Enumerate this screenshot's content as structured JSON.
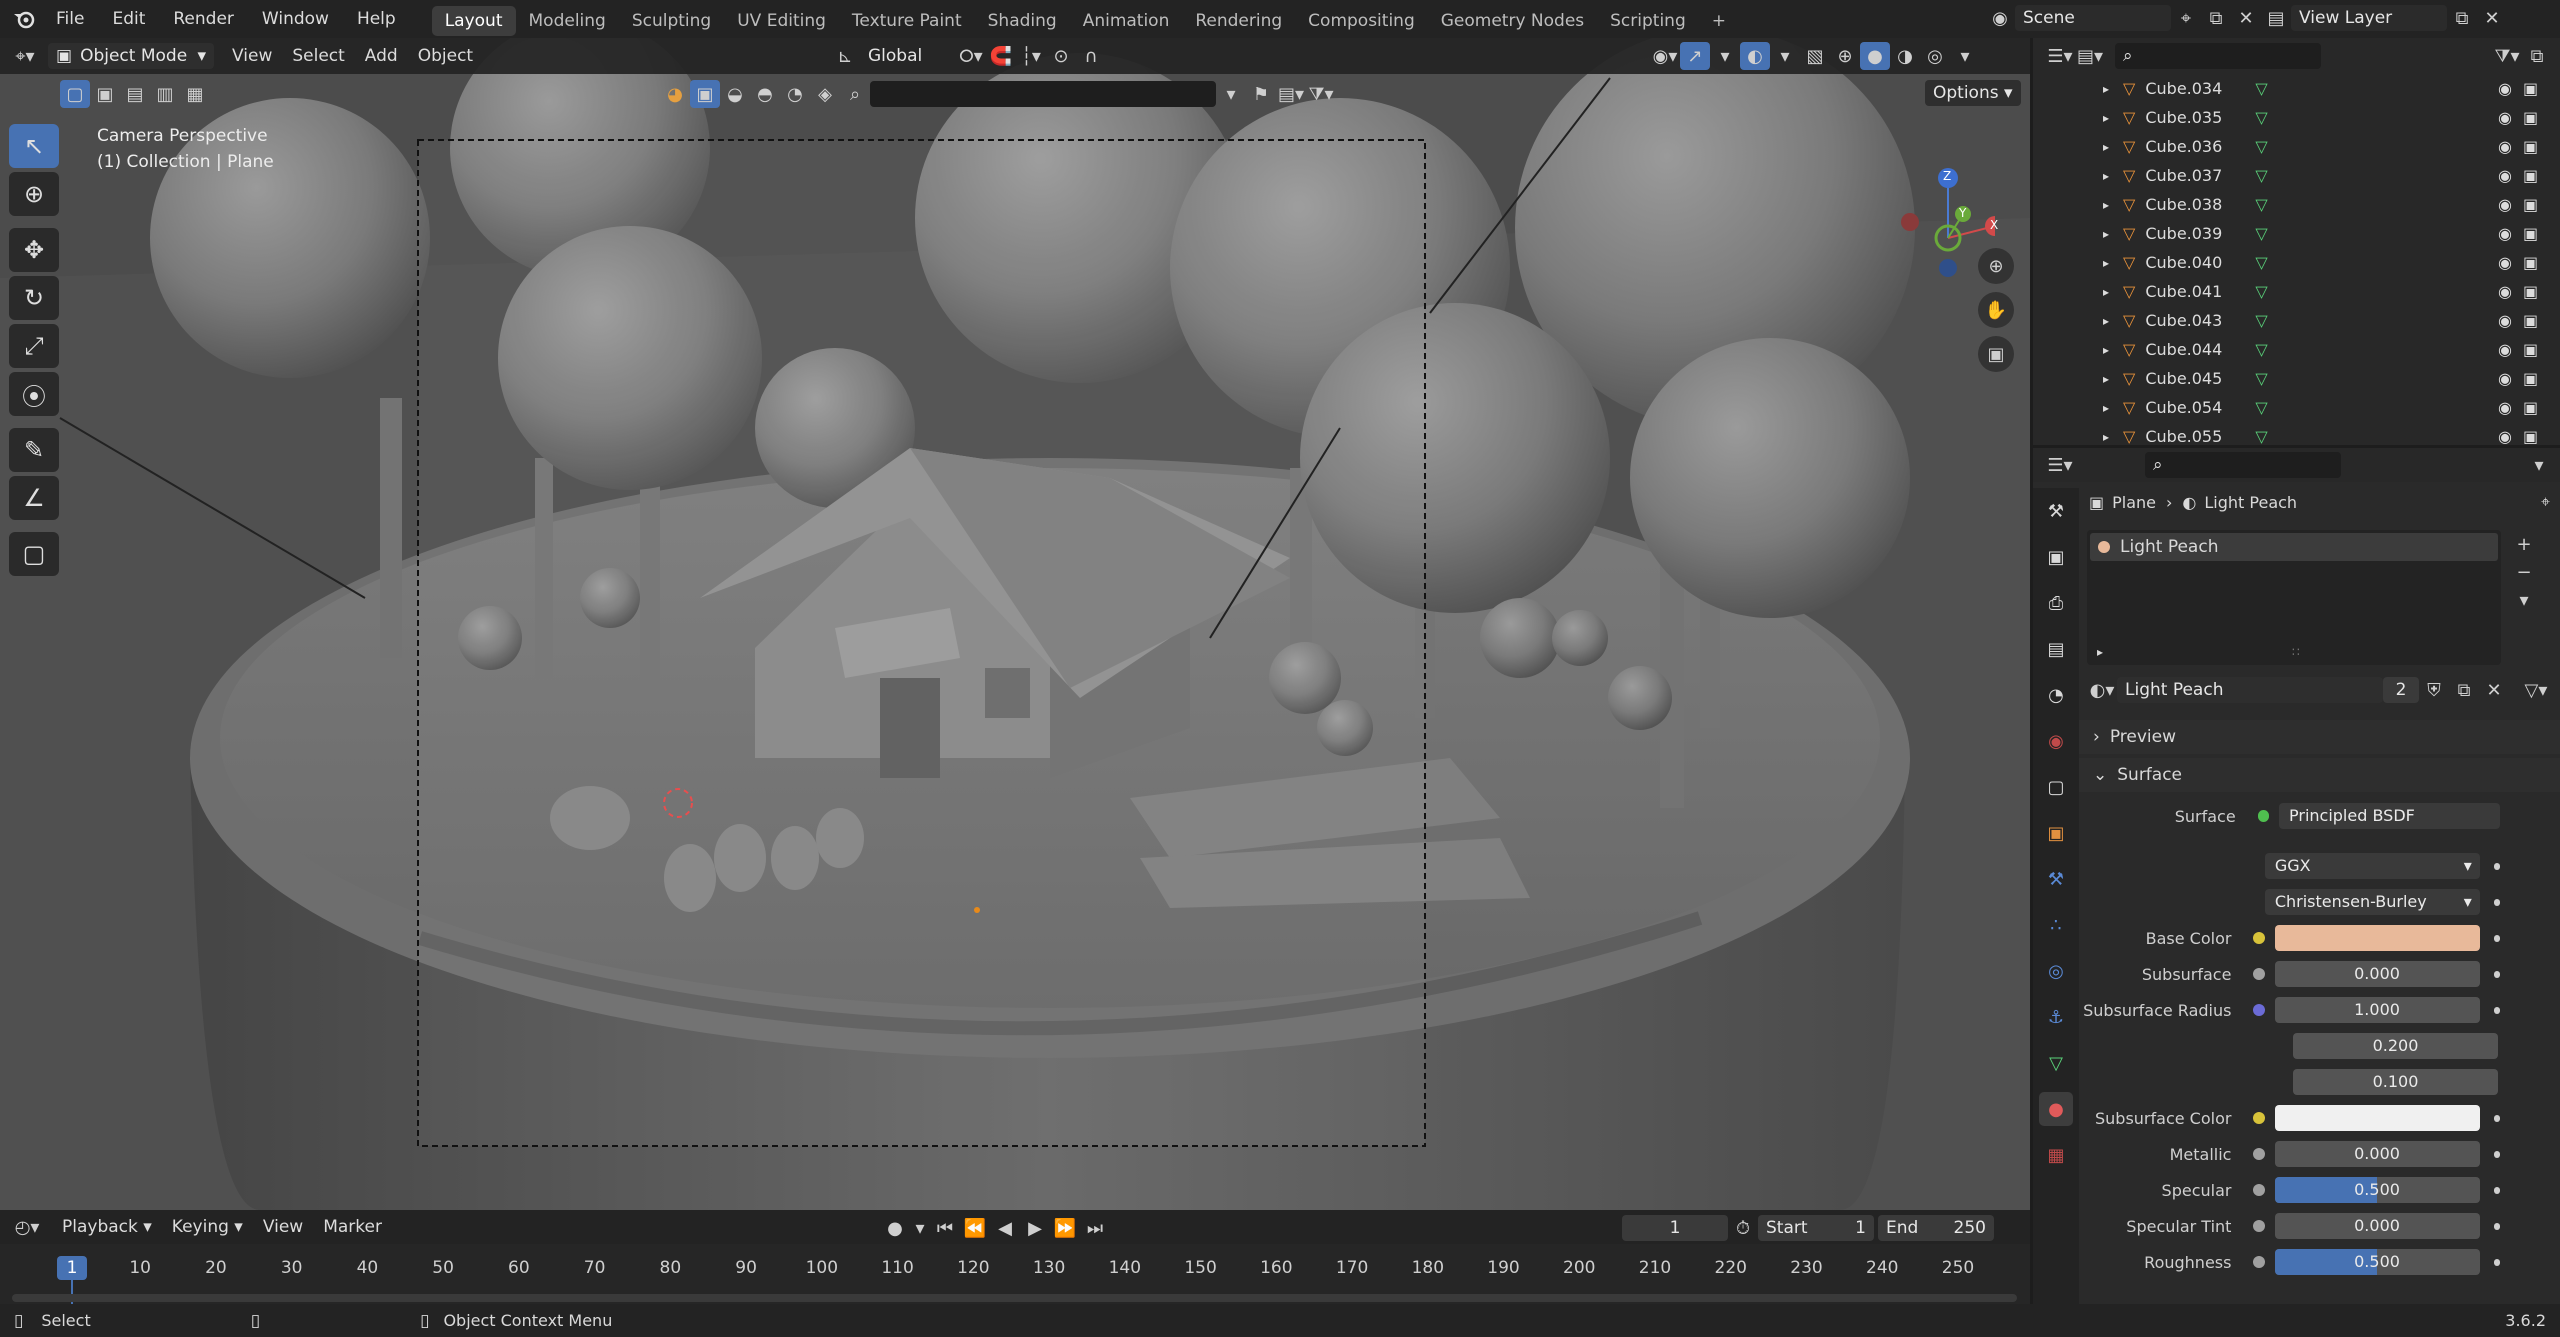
{
  "topbar": {
    "menus": [
      "File",
      "Edit",
      "Render",
      "Window",
      "Help"
    ],
    "workspaces": [
      "Layout",
      "Modeling",
      "Sculpting",
      "UV Editing",
      "Texture Paint",
      "Shading",
      "Animation",
      "Rendering",
      "Compositing",
      "Geometry Nodes",
      "Scripting"
    ],
    "active_workspace": "Layout",
    "add_tab": "+",
    "scene": "Scene",
    "view_layer": "View Layer"
  },
  "viewport_header": {
    "mode": "Object Mode",
    "menus": [
      "View",
      "Select",
      "Add",
      "Object"
    ],
    "transform_orientation": "Global",
    "options_label": "Options"
  },
  "viewport": {
    "overlay_line1": "Camera Perspective",
    "overlay_line2": "(1) Collection | Plane",
    "gizmo": {
      "z": "Z",
      "y": "Y",
      "x": "X"
    }
  },
  "outliner": {
    "items": [
      "Cube.034",
      "Cube.035",
      "Cube.036",
      "Cube.037",
      "Cube.038",
      "Cube.039",
      "Cube.040",
      "Cube.041",
      "Cube.043",
      "Cube.044",
      "Cube.045",
      "Cube.054",
      "Cube.055"
    ]
  },
  "properties": {
    "breadcrumb_object": "Plane",
    "breadcrumb_material": "Light Peach",
    "slot_name": "Light Peach",
    "material_name": "Light Peach",
    "user_count": "2",
    "panel_preview": "Preview",
    "panel_surface": "Surface",
    "surface_label": "Surface",
    "surface_value": "Principled BSDF",
    "distribution": "GGX",
    "subsurface_method": "Christensen-Burley",
    "rows": [
      {
        "label": "Base Color",
        "value": "",
        "kind": "color",
        "color": "#e8b99a",
        "dot": "#d8c33a"
      },
      {
        "label": "Subsurface",
        "value": "0.000",
        "kind": "num",
        "fill": 0,
        "dot": "#a0a0a0"
      },
      {
        "label": "Subsurface Radius",
        "value": "1.000",
        "kind": "num",
        "fill": 0,
        "dot": "#6b6bd6"
      },
      {
        "label": "",
        "value": "0.200",
        "kind": "num",
        "fill": 0,
        "dot": ""
      },
      {
        "label": "",
        "value": "0.100",
        "kind": "num",
        "fill": 0,
        "dot": ""
      },
      {
        "label": "Subsurface Color",
        "value": "",
        "kind": "color",
        "color": "#f0f0f0",
        "dot": "#d8c33a"
      },
      {
        "label": "Metallic",
        "value": "0.000",
        "kind": "num",
        "fill": 0,
        "dot": "#a0a0a0"
      },
      {
        "label": "Specular",
        "value": "0.500",
        "kind": "num",
        "fill": 0.5,
        "dot": "#a0a0a0"
      },
      {
        "label": "Specular Tint",
        "value": "0.000",
        "kind": "num",
        "fill": 0,
        "dot": "#a0a0a0"
      },
      {
        "label": "Roughness",
        "value": "0.500",
        "kind": "num",
        "fill": 0.5,
        "dot": "#a0a0a0"
      }
    ]
  },
  "timeline": {
    "menus": [
      "Playback",
      "Keying",
      "View",
      "Marker"
    ],
    "current_frame": "1",
    "start_label": "Start",
    "start": "1",
    "end_label": "End",
    "end": "250",
    "ticks": [
      "1",
      "10",
      "20",
      "30",
      "40",
      "50",
      "60",
      "70",
      "80",
      "90",
      "100",
      "110",
      "120",
      "130",
      "140",
      "150",
      "160",
      "170",
      "180",
      "190",
      "200",
      "210",
      "220",
      "230",
      "240",
      "250"
    ]
  },
  "statusbar": {
    "left": "Select",
    "middle": "Object Context Menu",
    "version": "3.6.2"
  }
}
